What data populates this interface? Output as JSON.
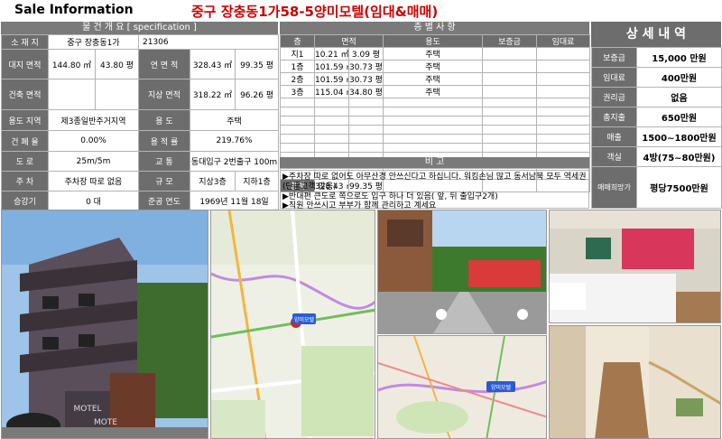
{
  "header": {
    "title": "Sale Information",
    "property": "중구 장충동1가58-5양미모텔(임대&매매)"
  },
  "overview": {
    "section_title": "물 건 개 요 [ specification ]",
    "rows": [
      [
        "소 재 지",
        "중구 장충동1가",
        "21306"
      ],
      [
        "대지 면적",
        "144.80 ㎡",
        "43.80 평",
        "연 면 적",
        "328.43 ㎡",
        "99.35 평"
      ],
      [
        "건축 면적",
        "",
        "",
        "지상 면적",
        "318.22 ㎡",
        "96.26 평"
      ],
      [
        "용도 지역",
        "제3종일반주거지역",
        "용 도",
        "주택"
      ],
      [
        "건 폐 율",
        "0.00%",
        "용 적 률",
        "219.76%"
      ],
      [
        "도 로",
        "25m/5m",
        "교 통",
        "동대입구 2번출구 100m"
      ],
      [
        "주 차",
        "주차장 따로 없음",
        "규 모",
        "지상3층",
        "지하1층"
      ],
      [
        "승강기",
        "0 대",
        "준공 연도",
        "1969년 11월 18일"
      ]
    ]
  },
  "floors": {
    "section_title": "층 별 사 항",
    "headers": [
      "층",
      "면적",
      "용도",
      "보증금",
      "임대료"
    ],
    "rows": [
      [
        "지1",
        "10.21 ㎡",
        "3.09 평",
        "주택"
      ],
      [
        "1층",
        "101.59 ㎡",
        "30.73 평",
        "주택"
      ],
      [
        "2층",
        "101.59 ㎡",
        "30.73 평",
        "주택"
      ],
      [
        "3층",
        "115.04 ㎡",
        "34.80 평",
        "주택"
      ]
    ],
    "total": [
      "합계",
      "328.43 ㎡",
      "99.35 평"
    ]
  },
  "remarks": {
    "title": "비 고",
    "lines": [
      "▶주차장 따로 없어도 아무산경 안쓰신다고 하십니다. 워킹손님 많고 동서남북 모두 역세권",
      "(단골고객 많음)",
      "▶반대편 큰도로 쪽으로도 입구 하나 더 있음( 앞, 뒤 출입구2개)",
      "▶직원 안쓰시고 부부가 함께 관리하고 계세요"
    ]
  },
  "details": {
    "title": "상 세 내 역",
    "rows": [
      [
        "보증금",
        "15,000 만원"
      ],
      [
        "임대료",
        "400만원"
      ],
      [
        "권리금",
        "없음"
      ],
      [
        "총지출",
        "650만원"
      ],
      [
        "매출",
        "1500~1800만원"
      ],
      [
        "객실",
        "4방(75~80만원)"
      ],
      [
        "매매희망가",
        "평당7500만원"
      ]
    ]
  },
  "photos": {
    "map_marker": "양미모텔",
    "map2_marker": "양미모텔",
    "sign1": "MOTEL",
    "sign2": "MOTE"
  },
  "colors": {
    "accent_red": "#cc0000",
    "label_gray": "#6d6d6d",
    "section_gray": "#7a7a7a"
  }
}
